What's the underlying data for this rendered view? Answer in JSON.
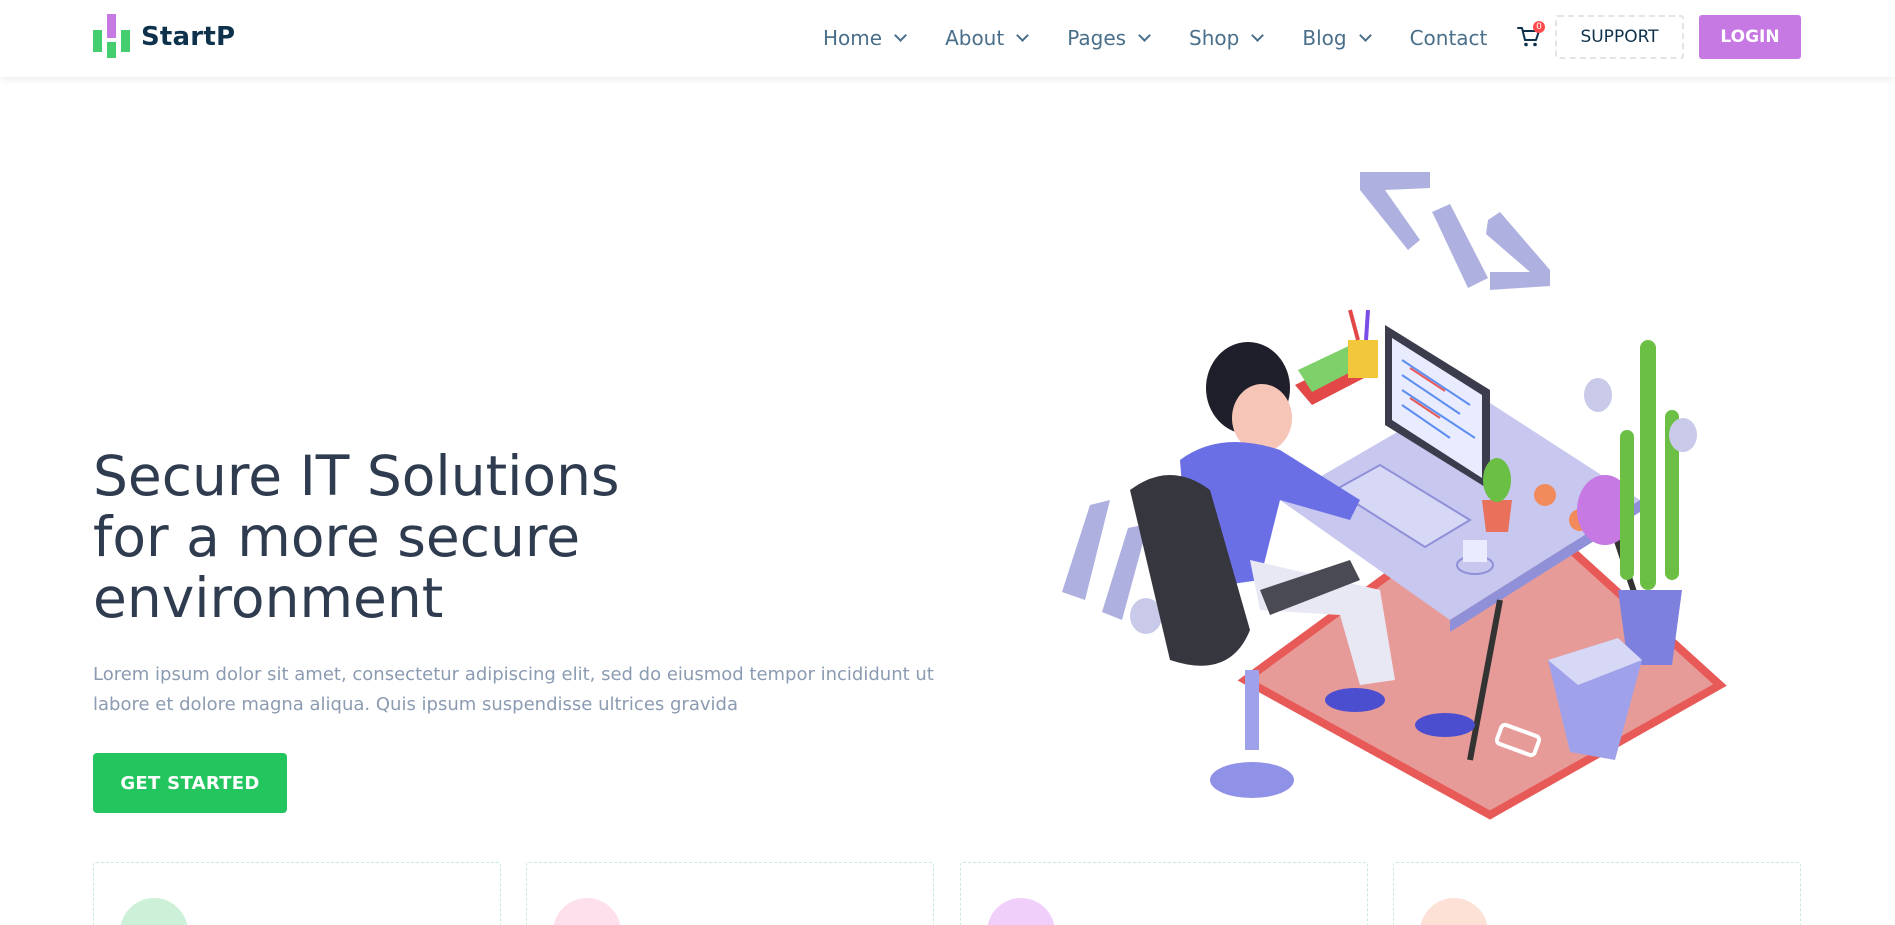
{
  "brand": {
    "name": "StartP"
  },
  "nav": {
    "items": [
      {
        "label": "Home",
        "has_dropdown": true
      },
      {
        "label": "About",
        "has_dropdown": true
      },
      {
        "label": "Pages",
        "has_dropdown": true
      },
      {
        "label": "Shop",
        "has_dropdown": true
      },
      {
        "label": "Blog",
        "has_dropdown": true
      },
      {
        "label": "Contact",
        "has_dropdown": false
      }
    ],
    "cart_count": "0",
    "support_label": "SUPPORT",
    "login_label": "LOGIN"
  },
  "hero": {
    "title_lines": [
      "Secure IT Solutions",
      "for a more secure",
      "environment"
    ],
    "description_lines": [
      "Lorem ipsum dolor sit amet, consectetur adipiscing elit, sed do eiusmod tempor incididunt ut",
      "labore et dolore magna aliqua. Quis ipsum suspendisse ultrices gravida"
    ],
    "cta_label": "GET STARTED"
  },
  "colors": {
    "primary_green": "#22c55e",
    "accent_purple": "#c679e3",
    "heading": "#2f3b4f",
    "text_muted": "#8b9bb1",
    "nav_text": "#4a6f8a"
  },
  "feature_cards": [
    {
      "icon": "monitor-icon",
      "icon_bg": "#cdf1d8"
    },
    {
      "icon": "code-icon",
      "icon_bg": "#fde0ec"
    },
    {
      "icon": "signal-icon",
      "icon_bg": "#f0d0fb"
    },
    {
      "icon": "settings-icon",
      "icon_bg": "#fde0d6"
    }
  ]
}
